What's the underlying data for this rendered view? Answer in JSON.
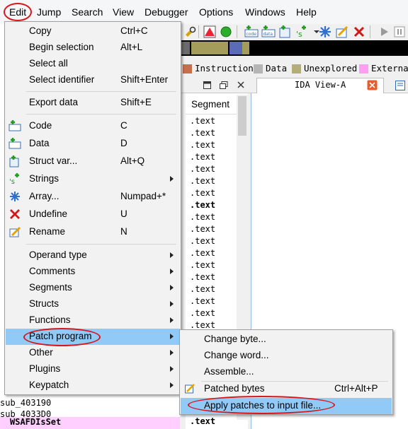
{
  "menubar": {
    "items": [
      {
        "label": "Edit"
      },
      {
        "label": "Jump"
      },
      {
        "label": "Search"
      },
      {
        "label": "View"
      },
      {
        "label": "Debugger"
      },
      {
        "label": "Options"
      },
      {
        "label": "Windows"
      },
      {
        "label": "Help"
      }
    ]
  },
  "legend": {
    "items": [
      {
        "label": "Instruction",
        "color": "#c86e49"
      },
      {
        "label": "Data",
        "color": "#b5b5b5"
      },
      {
        "label": "Unexplored",
        "color": "#b3ad7a"
      },
      {
        "label": "External",
        "color": "#ff9ef0"
      }
    ]
  },
  "segments_pane": {
    "header": "Segment",
    "rows": [
      ".text",
      ".text",
      ".text",
      ".text",
      ".text",
      ".text",
      ".text",
      ".text",
      ".text",
      ".text",
      ".text",
      ".text",
      ".text",
      ".text",
      ".text",
      ".text",
      ".text",
      ".text",
      ".text",
      ".text",
      ".text",
      ".text",
      ".text",
      ".text",
      ".text",
      ".text"
    ]
  },
  "ida_view": {
    "tab_label": "IDA View-A"
  },
  "left_pane": {
    "rows": [
      "sub_403190",
      "sub_4033D0",
      "WSAFDIsSet"
    ]
  },
  "edit_menu": {
    "items": [
      {
        "label": "Copy",
        "shortcut": "Ctrl+C"
      },
      {
        "label": "Begin selection",
        "shortcut": "Alt+L"
      },
      {
        "label": "Select all",
        "shortcut": ""
      },
      {
        "label": "Select identifier",
        "shortcut": "Shift+Enter"
      },
      {
        "label": "Export data",
        "shortcut": "Shift+E"
      },
      {
        "label": "Code",
        "shortcut": "C"
      },
      {
        "label": "Data",
        "shortcut": "D"
      },
      {
        "label": "Struct var...",
        "shortcut": "Alt+Q"
      },
      {
        "label": "Strings",
        "shortcut": ""
      },
      {
        "label": "Array...",
        "shortcut": "Numpad+*"
      },
      {
        "label": "Undefine",
        "shortcut": "U"
      },
      {
        "label": "Rename",
        "shortcut": "N"
      },
      {
        "label": "Operand type",
        "shortcut": ""
      },
      {
        "label": "Comments",
        "shortcut": ""
      },
      {
        "label": "Segments",
        "shortcut": ""
      },
      {
        "label": "Structs",
        "shortcut": ""
      },
      {
        "label": "Functions",
        "shortcut": ""
      },
      {
        "label": "Patch program",
        "shortcut": ""
      },
      {
        "label": "Other",
        "shortcut": ""
      },
      {
        "label": "Plugins",
        "shortcut": ""
      },
      {
        "label": "Keypatch",
        "shortcut": ""
      }
    ]
  },
  "patch_submenu": {
    "items": [
      {
        "label": "Change byte...",
        "shortcut": ""
      },
      {
        "label": "Change word...",
        "shortcut": ""
      },
      {
        "label": "Assemble...",
        "shortcut": ""
      },
      {
        "label": "Patched bytes",
        "shortcut": "Ctrl+Alt+P"
      },
      {
        "label": "Apply patches to input file...",
        "shortcut": ""
      }
    ]
  },
  "colors": {
    "highlight": "#91c9f7",
    "annotation_ring": "#d8161b",
    "legend_instruction": "#c86e49",
    "legend_data": "#b5b5b5",
    "legend_unexplored": "#b3ad7a",
    "legend_external": "#ff9ef0"
  }
}
